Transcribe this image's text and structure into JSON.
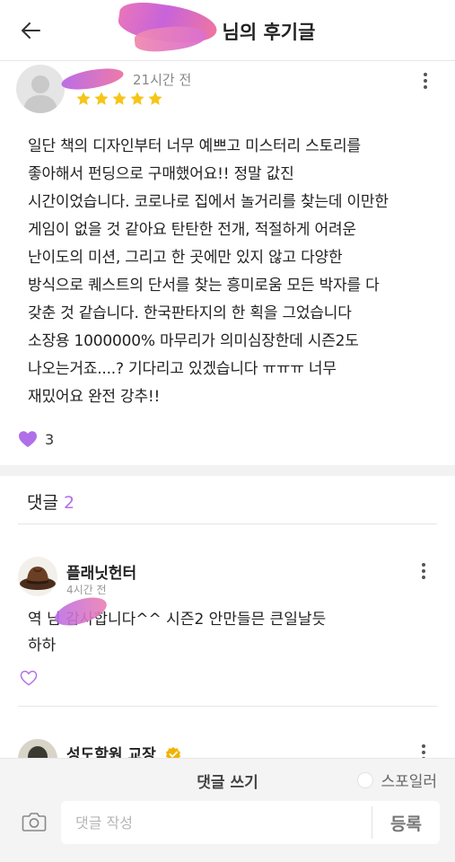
{
  "header": {
    "title_suffix": "님의 후기글",
    "back_icon": "back-arrow-icon"
  },
  "review": {
    "author": "",
    "time": "21시간 전",
    "rating": 5,
    "body": "일단 책의 디자인부터 너무 예쁘고 미스터리 스토리를\n좋아해서 펀딩으로 구매했어요!! 정말 값진\n시간이었습니다. 코로나로 집에서 놀거리를 찾는데 이만한\n게임이 없을 것 같아요 탄탄한 전개, 적절하게 어려운\n난이도의 미션, 그리고 한 곳에만 있지 않고 다양한\n방식으로 퀘스트의 단서를 찾는 흥미로움 모든 박자를 다\n갖춘 것 같습니다. 한국판타지의 한 획을 그었습니다\n소장용 1000000% 마무리가 의미심장한데 시즌2도\n나오는거죠....? 기다리고 있겠습니다 ㅠㅠㅠ 너무\n재밌어요 완전 강추!!",
    "likes": "3",
    "colors": {
      "star": "#f5c518",
      "heart": "#b06fe8"
    }
  },
  "comments_section": {
    "title": "댓글",
    "count": "2"
  },
  "comments": [
    {
      "author": "플래닛헌터",
      "time": "4시간 전",
      "body_line1": "역    님 감사합니다^^ 시즌2  안만들믄 큰일날듯",
      "body_line2": "하하"
    },
    {
      "author": "성도학원 교장",
      "verified": true
    }
  ],
  "composer": {
    "title": "댓글 쓰기",
    "spoiler_label": "스포일러",
    "input_placeholder": "댓글 작성",
    "submit_label": "등록"
  }
}
